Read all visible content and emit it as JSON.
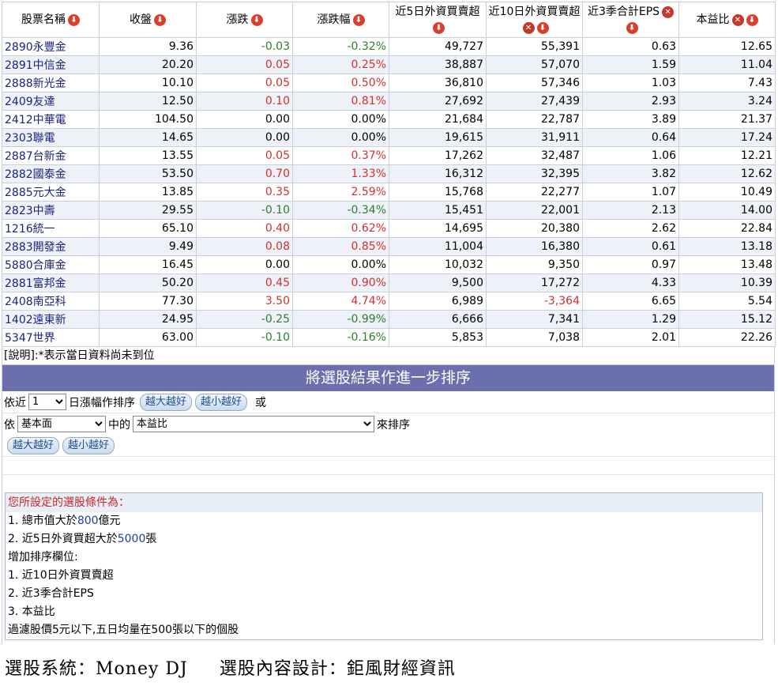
{
  "table": {
    "headers": [
      {
        "label": "股票名稱",
        "icons": [
          "down-arrow-icon"
        ]
      },
      {
        "label": "收盤",
        "icons": [
          "down-arrow-icon"
        ]
      },
      {
        "label": "漲跌",
        "icons": [
          "down-arrow-icon"
        ]
      },
      {
        "label": "漲跌幅",
        "icons": [
          "down-arrow-icon"
        ]
      },
      {
        "label": "近5日外資買賣超",
        "icons": [
          "down-arrow-icon"
        ]
      },
      {
        "label": "近10日外資買賣超",
        "icons": [
          "remove-icon",
          "down-arrow-icon"
        ]
      },
      {
        "label": "近3季合計EPS",
        "icons": [
          "remove-icon",
          "down-arrow-icon"
        ]
      },
      {
        "label": "本益比",
        "icons": [
          "remove-icon",
          "down-arrow-icon"
        ]
      }
    ],
    "rows": [
      {
        "name": "2890永豐金",
        "close": "9.36",
        "chg": "-0.03",
        "pct": "-0.32%",
        "f5": "49,727",
        "f10": "55,391",
        "eps": "0.63",
        "pe": "12.65"
      },
      {
        "name": "2891中信金",
        "close": "20.20",
        "chg": "0.05",
        "pct": "0.25%",
        "f5": "38,887",
        "f10": "57,070",
        "eps": "1.59",
        "pe": "11.04"
      },
      {
        "name": "2888新光金",
        "close": "10.10",
        "chg": "0.05",
        "pct": "0.50%",
        "f5": "36,810",
        "f10": "57,346",
        "eps": "1.03",
        "pe": "7.43"
      },
      {
        "name": "2409友達",
        "close": "12.50",
        "chg": "0.10",
        "pct": "0.81%",
        "f5": "27,692",
        "f10": "27,439",
        "eps": "2.93",
        "pe": "3.24"
      },
      {
        "name": "2412中華電",
        "close": "104.50",
        "chg": "0.00",
        "pct": "0.00%",
        "f5": "21,684",
        "f10": "22,787",
        "eps": "3.89",
        "pe": "21.37"
      },
      {
        "name": "2303聯電",
        "close": "14.65",
        "chg": "0.00",
        "pct": "0.00%",
        "f5": "19,615",
        "f10": "31,911",
        "eps": "0.64",
        "pe": "17.24"
      },
      {
        "name": "2887台新金",
        "close": "13.55",
        "chg": "0.05",
        "pct": "0.37%",
        "f5": "17,262",
        "f10": "32,487",
        "eps": "1.06",
        "pe": "12.21"
      },
      {
        "name": "2882國泰金",
        "close": "53.50",
        "chg": "0.70",
        "pct": "1.33%",
        "f5": "16,312",
        "f10": "32,395",
        "eps": "3.82",
        "pe": "12.62"
      },
      {
        "name": "2885元大金",
        "close": "13.85",
        "chg": "0.35",
        "pct": "2.59%",
        "f5": "15,768",
        "f10": "22,277",
        "eps": "1.07",
        "pe": "10.49"
      },
      {
        "name": "2823中壽",
        "close": "29.55",
        "chg": "-0.10",
        "pct": "-0.34%",
        "f5": "15,451",
        "f10": "22,001",
        "eps": "2.13",
        "pe": "14.00"
      },
      {
        "name": "1216統一",
        "close": "65.10",
        "chg": "0.40",
        "pct": "0.62%",
        "f5": "14,695",
        "f10": "20,380",
        "eps": "2.62",
        "pe": "22.84"
      },
      {
        "name": "2883開發金",
        "close": "9.49",
        "chg": "0.08",
        "pct": "0.85%",
        "f5": "11,004",
        "f10": "16,380",
        "eps": "0.61",
        "pe": "13.18"
      },
      {
        "name": "5880合庫金",
        "close": "16.45",
        "chg": "0.00",
        "pct": "0.00%",
        "f5": "10,032",
        "f10": "9,350",
        "eps": "0.97",
        "pe": "13.48"
      },
      {
        "name": "2881富邦金",
        "close": "50.20",
        "chg": "0.45",
        "pct": "0.90%",
        "f5": "9,500",
        "f10": "17,272",
        "eps": "4.33",
        "pe": "10.39"
      },
      {
        "name": "2408南亞科",
        "close": "77.30",
        "chg": "3.50",
        "pct": "4.74%",
        "f5": "6,989",
        "f10": "-3,364",
        "eps": "6.65",
        "pe": "5.54"
      },
      {
        "name": "1402遠東新",
        "close": "24.95",
        "chg": "-0.25",
        "pct": "-0.99%",
        "f5": "6,666",
        "f10": "7,341",
        "eps": "1.29",
        "pe": "15.12"
      },
      {
        "name": "5347世界",
        "close": "63.00",
        "chg": "-0.10",
        "pct": "-0.16%",
        "f5": "5,853",
        "f10": "7,038",
        "eps": "2.01",
        "pe": "22.26"
      }
    ],
    "note": "[說明]:*表示當日資料尚未到位"
  },
  "sort": {
    "title": "將選股結果作進一步排序",
    "row1_prefix": "依近",
    "days_value": "1",
    "row1_middle": "日漲幅作排序",
    "btn_desc": "越大越好",
    "btn_asc": "越小越好",
    "or_text": "或",
    "row2_prefix": "依",
    "category_value": "基本面",
    "row2_middle": "中的",
    "field_value": "本益比",
    "row2_suffix": "來排序"
  },
  "conditions": {
    "title": "您所設定的選股條件為：",
    "c1_prefix": "1.  總市值大於",
    "c1_value": "800",
    "c1_suffix": "億元",
    "c2_prefix": "2.  近5日外資買超大於",
    "c2_value": "5000",
    "c2_suffix": "張",
    "sort_title": "增加排序欄位:",
    "sort_items": [
      "1.  近10日外資買賣超",
      "2.  近3季合計EPS",
      "3.  本益比"
    ],
    "filter_note": "過濾股價5元以下,五日均量在500張以下的個股"
  },
  "footer": {
    "system": "選股系統：Money DJ",
    "designer": "選股內容設計：鉅風財經資訊"
  },
  "colors": {
    "up": "#d32f2f",
    "down": "#2e7d32",
    "header_bar": "#6c6fae"
  }
}
